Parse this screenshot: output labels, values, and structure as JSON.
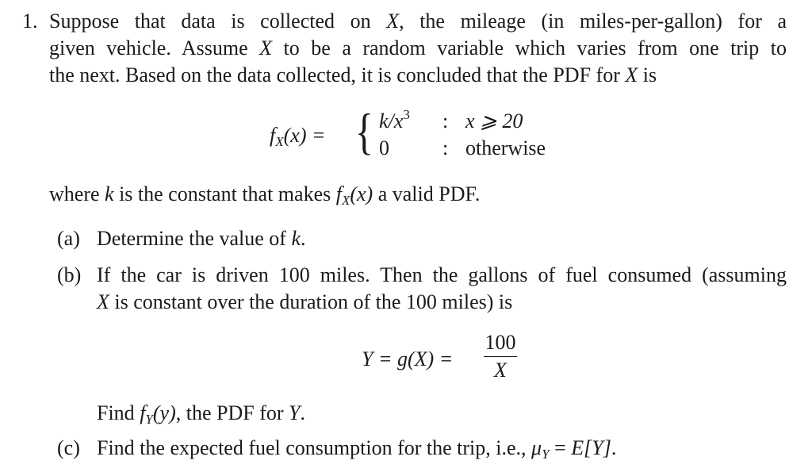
{
  "problem": {
    "number": "1.",
    "intro_lines": [
      [
        "Suppose that data is collected on ",
        "X",
        ", the mileage (in miles-per-gallon) for a"
      ],
      [
        "given vehicle. Assume ",
        "X",
        " to be a random variable which varies from one trip to"
      ],
      [
        "the next. Based on the data collected, it is concluded that the PDF for ",
        "X",
        " is"
      ]
    ],
    "pdf_equation": {
      "lhs_f": "f",
      "lhs_sub": "X",
      "lhs_arg": "(x) =",
      "case1_value_k": "k",
      "case1_value_rest": "/x",
      "case1_value_exp": "3",
      "case1_sep": ":",
      "case1_cond": "x ⩾ 20",
      "case2_value": "0",
      "case2_sep": ":",
      "case2_cond": "otherwise"
    },
    "where_line": {
      "pre": "where ",
      "k": "k",
      "mid": " is the constant that makes ",
      "f": "f",
      "sub": "X",
      "arg": "(x)",
      "post": " a valid PDF."
    },
    "parts": {
      "a": {
        "label": "(a)",
        "text_pre": "Determine the value of ",
        "var": "k",
        "text_post": "."
      },
      "b": {
        "label": "(b)",
        "line1": "If the car is driven 100 miles. Then the gallons of fuel consumed (assuming",
        "line2_var": "X",
        "line2_rest": " is constant over the duration of the 100 miles) is",
        "equation": {
          "lhs": "Y = g(X) =",
          "numerator": "100",
          "denominator": "X"
        },
        "find": {
          "pre": "Find ",
          "f": "f",
          "sub": "Y",
          "arg": "(y)",
          "post": ", the PDF for ",
          "var": "Y",
          "end": "."
        }
      },
      "c": {
        "label": "(c)",
        "text": "Find the expected fuel consumption for the trip, i.e., ",
        "mu": "μ",
        "mu_sub": "Y",
        "eq": " = ",
        "expect": "E[Y]",
        "end": "."
      }
    }
  }
}
